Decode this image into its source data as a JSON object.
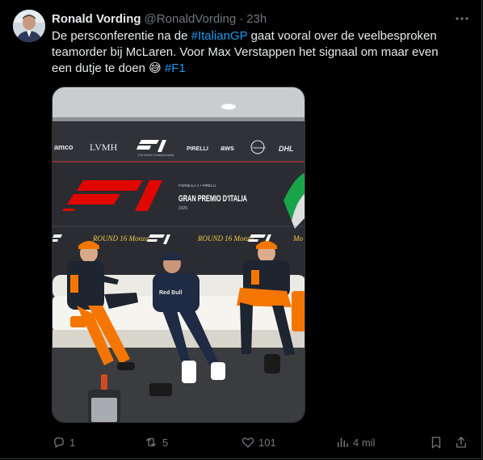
{
  "tweet": {
    "author_name": "Ronald Vording",
    "handle": "@RonaldVording",
    "separator": "·",
    "time": "23h",
    "text": {
      "p1": "De persconferentie na de ",
      "tag1": "#ItalianGP",
      "p2": " gaat vooral over de veelbesproken teamorder bij McLaren. Voor Max Verstappen het signaal om maar even een dutje te doen ",
      "emoji": "😅",
      "p3": " ",
      "tag2": "#F1"
    }
  },
  "media": {
    "sponsors": [
      "amco",
      "LVMH",
      "F1",
      "PIRELLI",
      "aws",
      "Heineken",
      "DHL"
    ],
    "backdrop_title": "GRAN PREMIO D'ITALIA",
    "backdrop_line1": "FORMULA 1 • PIRELLI",
    "backdrop_year": "2025",
    "strip_items": [
      "ROUND 16 Monza",
      "F1",
      "ROUND 16 Monza",
      "F1",
      "Mo"
    ],
    "shirt_text": "Red Bull"
  },
  "actions": {
    "replies": "1",
    "reposts": "5",
    "likes": "101",
    "views": "4 mil"
  },
  "icons": {
    "more": "more-horizontal-icon",
    "reply": "reply-icon",
    "repost": "repost-icon",
    "like": "like-icon",
    "views": "views-icon",
    "bookmark": "bookmark-icon",
    "share": "share-icon"
  },
  "colors": {
    "background": "#000000",
    "text": "#e7e9ea",
    "muted": "#71767b",
    "link": "#1d9bf0",
    "papaya": "#f47600"
  }
}
